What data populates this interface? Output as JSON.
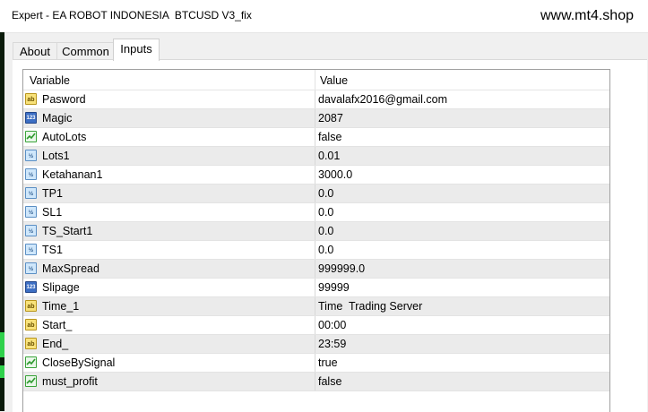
{
  "window": {
    "title": "Expert - EA ROBOT INDONESIA  BTCUSD V3_fix",
    "watermark": "www.mt4.shop"
  },
  "tabs": [
    {
      "label": "About",
      "active": false
    },
    {
      "label": "Common",
      "active": false
    },
    {
      "label": "Inputs",
      "active": true
    }
  ],
  "table": {
    "columns": [
      "Variable",
      "Value"
    ],
    "rows": [
      {
        "icon": "string-icon",
        "name": "Pasword",
        "value": "davalafx2016@gmail.com"
      },
      {
        "icon": "integer-icon",
        "name": "Magic",
        "value": "2087"
      },
      {
        "icon": "boolean-icon",
        "name": "AutoLots",
        "value": "false"
      },
      {
        "icon": "double-icon",
        "name": "Lots1",
        "value": "0.01"
      },
      {
        "icon": "double-icon",
        "name": "Ketahanan1",
        "value": "3000.0"
      },
      {
        "icon": "double-icon",
        "name": "TP1",
        "value": "0.0"
      },
      {
        "icon": "double-icon",
        "name": "SL1",
        "value": "0.0"
      },
      {
        "icon": "double-icon",
        "name": "TS_Start1",
        "value": "0.0"
      },
      {
        "icon": "double-icon",
        "name": "TS1",
        "value": "0.0"
      },
      {
        "icon": "double-icon",
        "name": "MaxSpread",
        "value": "999999.0"
      },
      {
        "icon": "integer-icon",
        "name": "Slipage",
        "value": "99999"
      },
      {
        "icon": "string-icon",
        "name": "Time_1",
        "value": "Time  Trading Server"
      },
      {
        "icon": "string-icon",
        "name": "Start_",
        "value": "00:00"
      },
      {
        "icon": "string-icon",
        "name": "End_",
        "value": "23:59"
      },
      {
        "icon": "boolean-icon",
        "name": "CloseBySignal",
        "value": "true"
      },
      {
        "icon": "boolean-icon",
        "name": "must_profit",
        "value": "false"
      }
    ]
  },
  "colors": {
    "accent_string": "#f8e27a",
    "accent_integer": "#3d6fc4",
    "accent_double": "#cfe7fb",
    "accent_boolean": "#3aa33a",
    "row_alt": "#ebebeb"
  }
}
